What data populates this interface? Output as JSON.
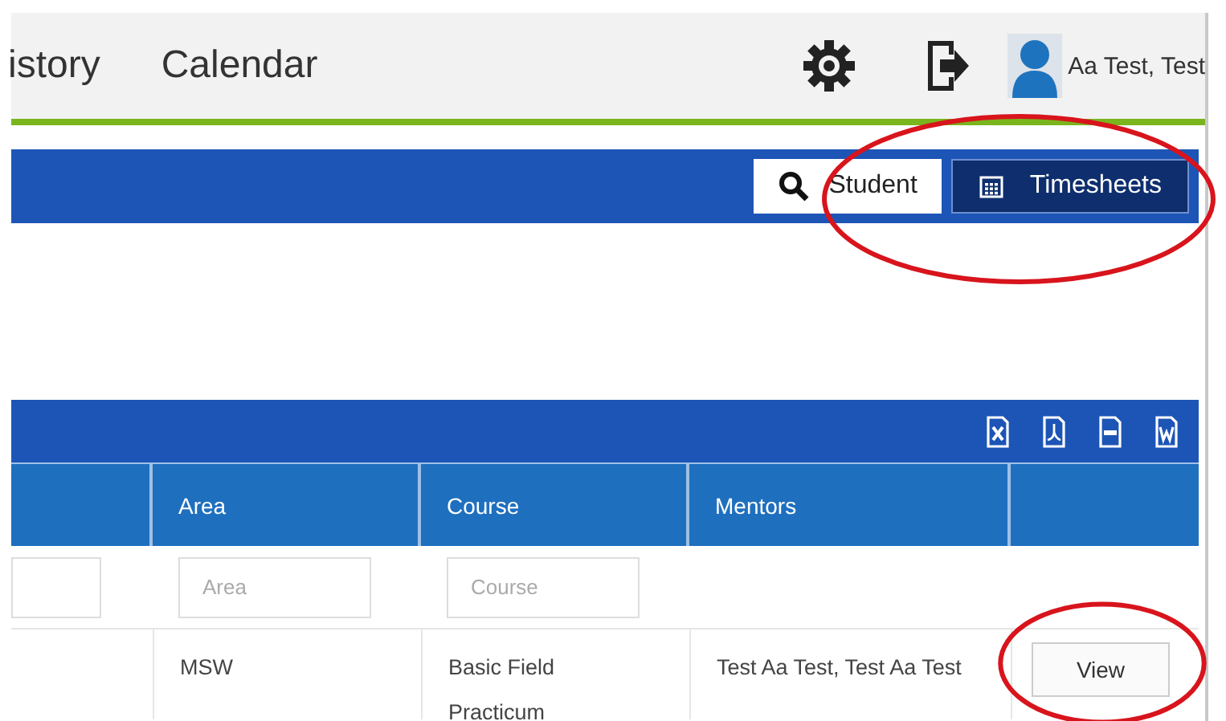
{
  "nav": {
    "items": [
      {
        "label": "istory"
      },
      {
        "label": "Calendar"
      }
    ],
    "user": "Aa Test, Test"
  },
  "toolbar": {
    "buttons": [
      {
        "kind": "search",
        "label": "Student",
        "selected": false
      },
      {
        "kind": "calendar",
        "label": "Timesheets",
        "selected": true
      }
    ]
  },
  "table": {
    "export_icons": [
      {
        "kind": "excel"
      },
      {
        "kind": "pdf"
      },
      {
        "kind": "csv"
      },
      {
        "kind": "word"
      }
    ],
    "columns": [
      {
        "filter_field": true
      },
      {
        "label": "Area",
        "placeholder": "Area"
      },
      {
        "label": "Course",
        "placeholder": "Course"
      },
      {
        "label": "Mentors"
      },
      {}
    ],
    "rows": [
      {
        "cells": [
          "",
          "MSW",
          "Basic Field Practicum",
          "Test Aa Test, Test Aa Test"
        ],
        "action": "View"
      }
    ]
  },
  "annotations": [
    {
      "kind": "ellipse"
    },
    {
      "kind": "ellipse"
    }
  ]
}
